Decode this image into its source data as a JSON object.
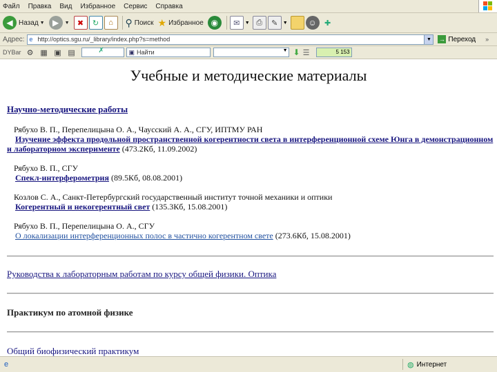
{
  "menu": [
    "Файл",
    "Правка",
    "Вид",
    "Избранное",
    "Сервис",
    "Справка"
  ],
  "toolbar": {
    "back_label": "Назад",
    "search_label": "Поиск",
    "favorites_label": "Избранное"
  },
  "address": {
    "label": "Адрес:",
    "url": "http://optics.sgu.ru/_library/index.php?s=method",
    "go_label": "Переход"
  },
  "linkbar": {
    "label": "DYBar",
    "field_text": "Найти",
    "counter": "5 153"
  },
  "page": {
    "title": "Учебные и методические материалы",
    "section1": "Научно-методические работы",
    "entries": [
      {
        "authors": "Рябухо В. П., Перепелицына О. А., Чаусский А. А., СГУ, ИПТМУ РАН",
        "link_line1": "Изучение эффекта продольной пространственной когерентности света в интерференционной схеме Юнга в демонстрационном",
        "link_line2": "и лабораторном эксперименте",
        "meta": " (473.2Кб, 11.09.2002)"
      },
      {
        "authors": "Рябухо В. П., СГУ",
        "link": "Спекл-интерферометрия",
        "meta": " (89.5Кб, 08.08.2001)"
      },
      {
        "authors": "Козлов С. А., Санкт-Петербургский государственный институт точной механики и оптики",
        "link": "Когерентный и некогерентный свет",
        "meta": " (135.3Кб, 15.08.2001)"
      },
      {
        "authors": "Рябухо В. П., Перепелицына О. А., СГУ",
        "link": "О локализации интерференционных полос в частично когерентном свете",
        "meta": " (273.6Кб, 15.08.2001)"
      }
    ],
    "section2": "Руководства к лабораторным работам по курсу общей физики. Оптика",
    "section3": "Практикум по атомной физике",
    "section4": "Общий биофизический практикум"
  },
  "status": {
    "zone": "Интернет"
  }
}
